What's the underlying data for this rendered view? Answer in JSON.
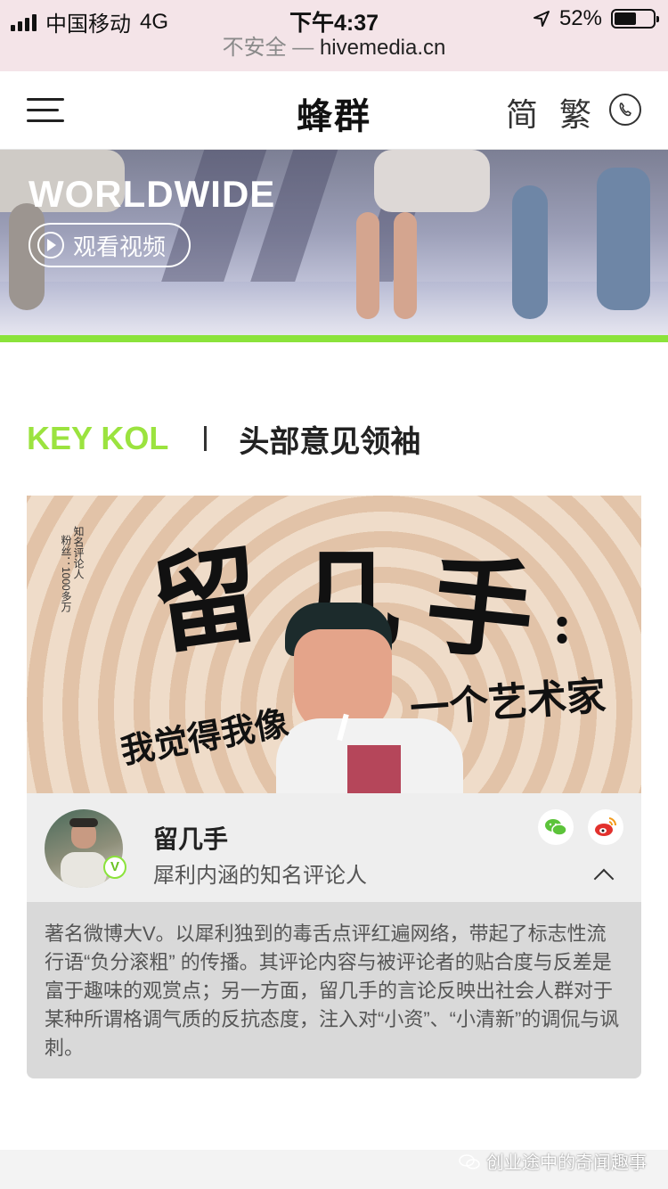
{
  "status_bar": {
    "carrier": "中国移动",
    "network": "4G",
    "time": "下午4:37",
    "battery": "52%",
    "battery_level": 0.52
  },
  "url_bar": {
    "security": "不安全 —",
    "host": "hivemedia.cn"
  },
  "header": {
    "logo": "蜂群",
    "lang_simplified": "简",
    "lang_traditional": "繁"
  },
  "banner": {
    "title": "WORLDWIDE",
    "watch_label": "观看视频"
  },
  "section": {
    "title_en": "KEY KOL",
    "title_cn": "头部意见领袖"
  },
  "kol": {
    "poster": {
      "big_text": [
        "留",
        "几",
        "手",
        ":"
      ],
      "subtitle": "一个艺术家",
      "tagline": "我觉得我像",
      "side_note_1": "知名评论人",
      "side_note_2": "粉丝：1000多万"
    },
    "avatar_badge": "V",
    "name": "留几手",
    "description": "犀利内涵的知名评论人",
    "bio": "著名微博大V。以犀利独到的毒舌点评红遍网络，带起了标志性流行语“负分滚粗” 的传播。其评论内容与被评论者的贴合度与反差是富于趣味的观赏点；另一方面，留几手的言论反映出社会人群对于某种所谓格调气质的反抗态度，注入对“小资”、“小清新”的调侃与讽刺。"
  },
  "watermark": "创业途中的奇闻趣事",
  "colors": {
    "accent": "#8be33b",
    "key_kol": "#9be33f"
  }
}
